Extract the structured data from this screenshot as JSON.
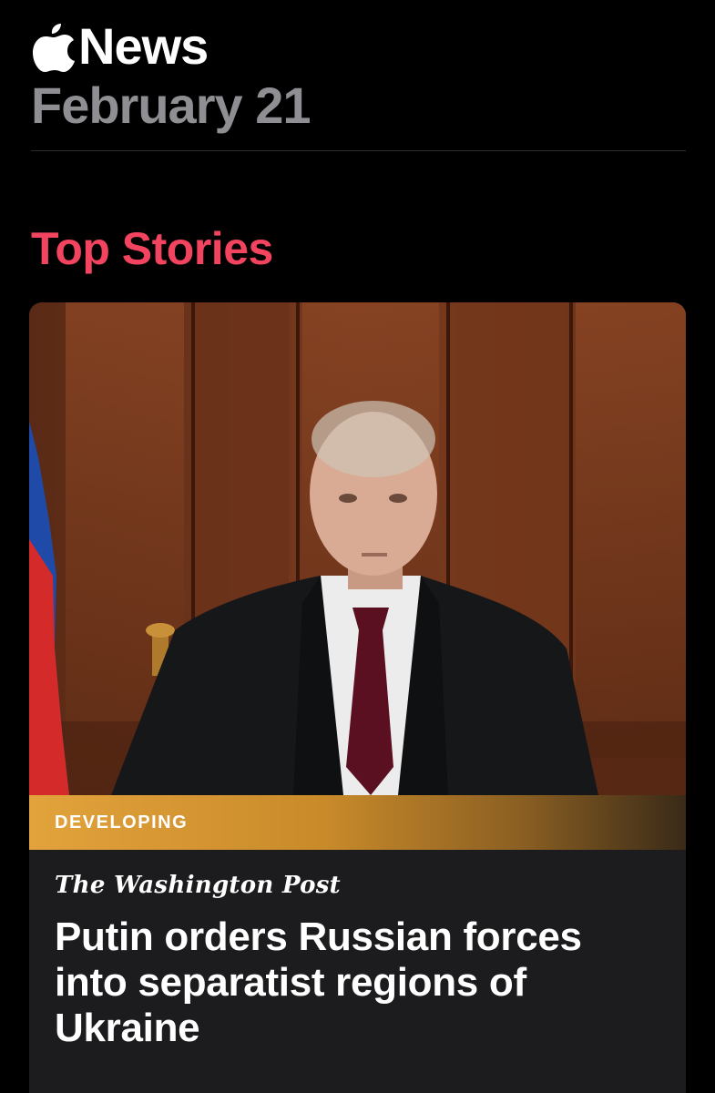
{
  "app": {
    "brand_name": "News",
    "logo_icon": "apple-logo-icon",
    "date": "February 21"
  },
  "section": {
    "title": "Top Stories",
    "accent_color": "#f2445f"
  },
  "top_story": {
    "badge": "DEVELOPING",
    "publisher": "The Washington Post",
    "headline": "Putin orders Russian forces into separatist regions of Ukraine",
    "image_icon": "news-photo"
  },
  "colors": {
    "background": "#000000",
    "card": "#1c1c1e",
    "date_gray": "#8e8e93",
    "badge_gold": "#e2a33c"
  }
}
